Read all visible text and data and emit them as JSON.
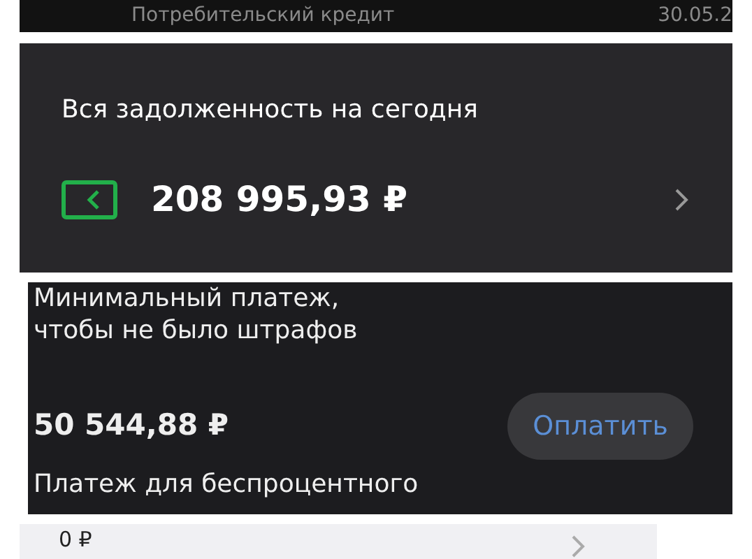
{
  "top_row": {
    "product": "Потребительский кредит",
    "date": "30.05.2"
  },
  "debt_card": {
    "title": "Вся задолженность на сегодня",
    "amount": "208 995,93 ₽"
  },
  "payment_card": {
    "title": "Минимальный платеж,\nчтобы не было штрафов",
    "amount": "50 544,88 ₽",
    "button": "Оплатить",
    "subtitle": "Платеж для беспроцентного"
  },
  "next_row": {
    "amount": "0 ₽"
  }
}
